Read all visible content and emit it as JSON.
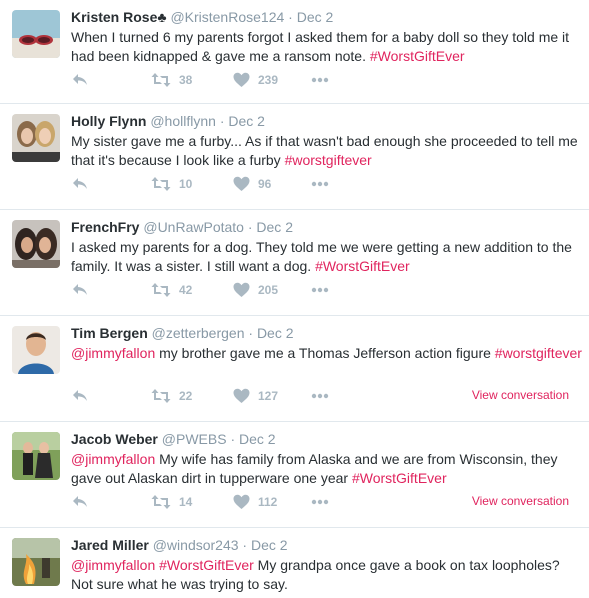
{
  "tweets": [
    {
      "name": "Kristen Rose♣",
      "handle": "@KristenRose124",
      "separator": "·",
      "date": "Dec 2",
      "text": "When I turned 6 my parents forgot I asked them for a baby doll so they told me it had been kidnapped & gave me a ransom note. ",
      "hashtag": "#WorstGiftEver",
      "retweets": "38",
      "likes": "239"
    },
    {
      "name": "Holly Flynn",
      "handle": "@hollflynn",
      "separator": "·",
      "date": "Dec 2",
      "text": "My sister gave me a furby... As if that wasn't bad enough she proceeded to tell me that it's because I look like a furby ",
      "hashtag": "#worstgiftever",
      "retweets": "10",
      "likes": "96"
    },
    {
      "name": "FrenchFry",
      "handle": "@UnRawPotato",
      "separator": "·",
      "date": "Dec 2",
      "text": "I asked my parents for a dog. They told me we were getting a new addition to the family. It was a sister. I still want a dog. ",
      "hashtag": "#WorstGiftEver",
      "retweets": "42",
      "likes": "205"
    },
    {
      "name": "Tim Bergen",
      "handle": "@zetterbergen",
      "separator": "·",
      "date": "Dec 2",
      "mention": "@jimmyfallon",
      "text": " my brother gave me a Thomas Jefferson action figure ",
      "hashtag": "#worstgiftever",
      "retweets": "22",
      "likes": "127",
      "view_conversation": "View conversation"
    },
    {
      "name": "Jacob Weber",
      "handle": "@PWEBS",
      "separator": "·",
      "date": "Dec 2",
      "mention": "@jimmyfallon",
      "text": " My wife has family from Alaska and we are from Wisconsin, they gave out Alaskan dirt in tupperware one year ",
      "hashtag": "#WorstGiftEver",
      "retweets": "14",
      "likes": "112",
      "view_conversation": "View conversation"
    },
    {
      "name": "Jared Miller",
      "handle": "@windsor243",
      "separator": "·",
      "date": "Dec 2",
      "mention": "@jimmyfallon",
      "hashtag": "#WorstGiftEver",
      "text": " My grandpa once gave a book on tax loopholes? Not sure what he was trying to say."
    }
  ],
  "icons": {
    "reply": "reply-icon",
    "retweet": "retweet-icon",
    "like": "heart-icon",
    "more": "more-icon"
  },
  "colors": {
    "accent": "#e0245e",
    "name": "#292f33",
    "muted": "#8899a6",
    "action": "#aab8c2",
    "divider": "#e1e8ed"
  }
}
